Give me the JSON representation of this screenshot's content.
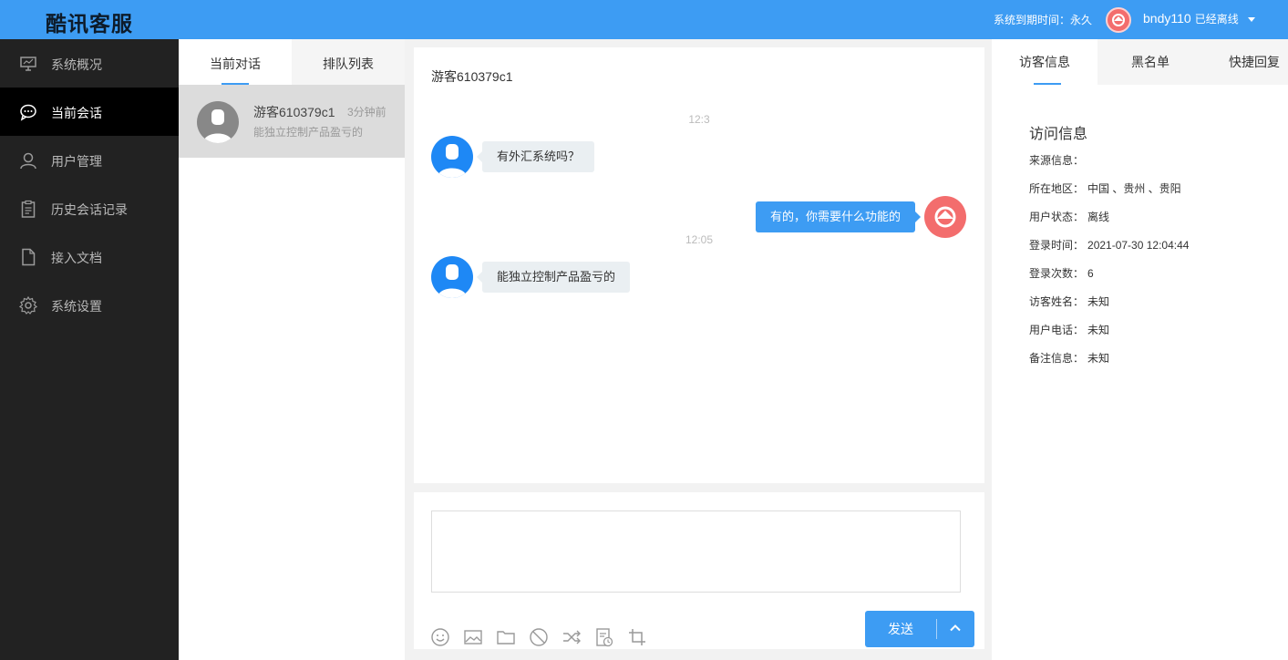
{
  "topbar": {
    "brand": "酷讯客服",
    "expiry": "系统到期时间：永久",
    "username": "bndy110",
    "status": "已经离线"
  },
  "sidebar": {
    "items": [
      {
        "label": "系统概况",
        "icon": "monitor-icon",
        "active": false
      },
      {
        "label": "当前会话",
        "icon": "chat-bubble-icon",
        "active": true
      },
      {
        "label": "用户管理",
        "icon": "user-icon",
        "active": false
      },
      {
        "label": "历史会话记录",
        "icon": "clipboard-icon",
        "active": false
      },
      {
        "label": "接入文档",
        "icon": "document-icon",
        "active": false
      },
      {
        "label": "系统设置",
        "icon": "gear-icon",
        "active": false
      }
    ]
  },
  "convlist": {
    "tabs": [
      "当前对话",
      "排队列表"
    ],
    "items": [
      {
        "name": "游客610379c1",
        "time": "3分钟前",
        "preview": "能独立控制产品盈亏的"
      }
    ]
  },
  "chat": {
    "title": "游客610379c1",
    "messages": [
      {
        "type": "time",
        "text": "12:3"
      },
      {
        "type": "visitor",
        "text": "有外汇系统吗？"
      },
      {
        "type": "agent",
        "text": "有的，你需要什么功能的"
      },
      {
        "type": "time",
        "text": "12:05"
      },
      {
        "type": "visitor",
        "text": "能独立控制产品盈亏的"
      }
    ]
  },
  "composer": {
    "tools": [
      "emoji-icon",
      "image-icon",
      "folder-icon",
      "block-icon",
      "transfer-icon",
      "history-icon",
      "crop-icon"
    ],
    "send_label": "发送"
  },
  "rpanel": {
    "tabs": [
      "访客信息",
      "黑名单",
      "快捷回复"
    ],
    "section_title": "访问信息",
    "rows": [
      {
        "label": "来源信息：",
        "value": ""
      },
      {
        "label": "所在地区：",
        "value": "中国 、贵州 、贵阳"
      },
      {
        "label": "用户状态：",
        "value": "离线"
      },
      {
        "label": "登录时间：",
        "value": "2021-07-30 12:04:44"
      },
      {
        "label": "登录次数：",
        "value": "6"
      },
      {
        "label": "访客姓名：",
        "value": "未知"
      },
      {
        "label": "用户电话：",
        "value": "未知"
      },
      {
        "label": "备注信息：",
        "value": "未知"
      }
    ]
  },
  "colors": {
    "accent": "#3d9cf3",
    "sidebar_bg": "#222222",
    "agent_avatar": "#f36d6d"
  }
}
